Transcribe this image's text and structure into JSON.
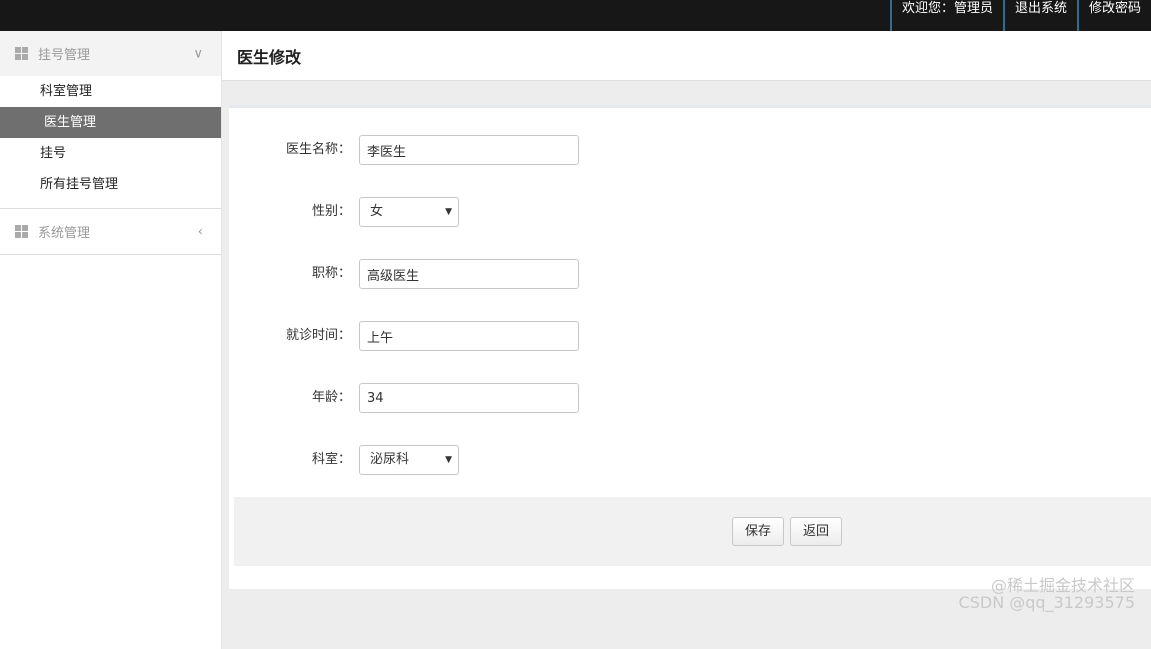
{
  "topbar": {
    "welcome": "欢迎您：管理员",
    "logout": "退出系统",
    "change_password": "修改密码"
  },
  "sidebar": {
    "sections": [
      {
        "title": "挂号管理",
        "arrow": "∨",
        "items": [
          "科室管理",
          "医生管理",
          "挂号",
          "所有挂号管理"
        ],
        "active_index": 1
      },
      {
        "title": "系统管理",
        "arrow": "‹"
      }
    ]
  },
  "main": {
    "page_title": "医生修改",
    "form": {
      "name": {
        "label": "医生名称：",
        "value": "李医生"
      },
      "gender": {
        "label": "性别：",
        "value": "女"
      },
      "title": {
        "label": "职称：",
        "value": "高级医生"
      },
      "time": {
        "label": "就诊时间：",
        "value": "上午"
      },
      "age": {
        "label": "年龄：",
        "value": "34"
      },
      "department": {
        "label": "科室：",
        "value": "泌尿科"
      }
    },
    "buttons": {
      "save": "保存",
      "back": "返回"
    }
  },
  "watermark": {
    "line1": "@稀土掘金技术社区",
    "line2": "CSDN @qq_31293575"
  }
}
